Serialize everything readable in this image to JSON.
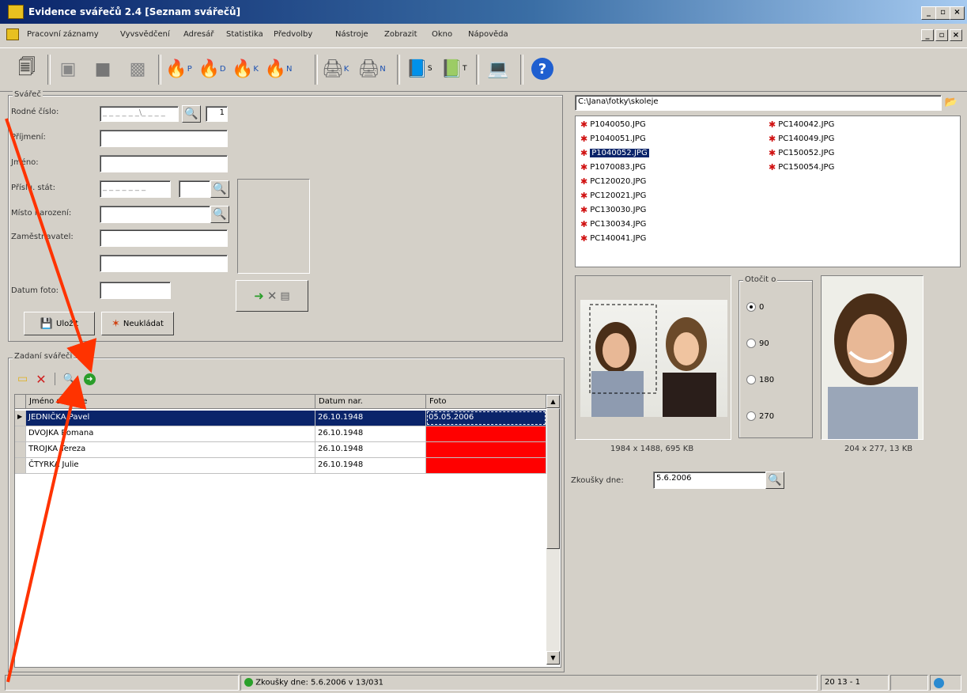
{
  "window": {
    "title": "Evidence svářečů 2.4  [Seznam svářečů]",
    "buttons": [
      "_",
      "▫",
      "×"
    ]
  },
  "menu": {
    "items": [
      "Pracovní záznamy",
      "Vyvsvědčení",
      "Adresář",
      "Statistika",
      "Předvolby",
      "Nástroje",
      "Zobrazit",
      "Okno",
      "Nápověda"
    ]
  },
  "toolbar": {
    "icons": [
      {
        "name": "doc-icon",
        "glyph": "🗐"
      },
      {
        "name": "stamp-icon",
        "glyph": "▣"
      },
      {
        "name": "stop-icon",
        "glyph": "■"
      },
      {
        "name": "tools-icon",
        "glyph": "▩"
      },
      {
        "name": "torch-p-icon",
        "glyph": "🔥",
        "sub": "P"
      },
      {
        "name": "torch-d-icon",
        "glyph": "🔥",
        "sub": "D"
      },
      {
        "name": "torch-zk-icon",
        "glyph": "🔥",
        "sub": "K"
      },
      {
        "name": "torch-en-icon",
        "glyph": "🔥",
        "sub": "N"
      },
      {
        "name": "print-zk-icon",
        "glyph": "🖨",
        "sub": "K"
      },
      {
        "name": "print-en-icon",
        "glyph": "🖨",
        "sub": "N"
      },
      {
        "name": "book-s-icon",
        "glyph": "📘",
        "sub": "S"
      },
      {
        "name": "book-t-icon",
        "glyph": "📗",
        "sub": "T"
      },
      {
        "name": "computer-icon",
        "glyph": "💻"
      },
      {
        "name": "help-icon",
        "glyph": "?"
      }
    ]
  },
  "welder": {
    "group_label": "Svářeč",
    "rodne_cislo_label": "Rodné číslo:",
    "rodne_cislo_value": "_ _ _ _ _ _\\_ _ _ _",
    "rodne_cislo_suffix": "1",
    "prijmeni_label": "Příjmení:",
    "jmeno_label": "Jméno:",
    "prist_label": "Příslu. stát:",
    "prist_value": "_ _ _ _ _ _ _",
    "misto_label": "Místo narození:",
    "zamestnavatel_label": "Zaměstnavatel:",
    "datum_foto_label": "Datum foto:",
    "ulozit": "Uložit",
    "neukladat": "Neukládat"
  },
  "list": {
    "group_label": "Zadaní svářeči",
    "columns": [
      "Jméno svářeče",
      "Datum nar.",
      "Foto"
    ],
    "rows": [
      {
        "name": "JEDNIČKA Pavel",
        "date": "26.10.1948",
        "foto": "05.05.2006",
        "selected": true,
        "red": false
      },
      {
        "name": "DVOJKA Romana",
        "date": "26.10.1948",
        "foto": "",
        "selected": false,
        "red": true
      },
      {
        "name": "TROJKA Tereza",
        "date": "26.10.1948",
        "foto": "",
        "selected": false,
        "red": true
      },
      {
        "name": "ČTYRKA Julie",
        "date": "26.10.1948",
        "foto": "",
        "selected": false,
        "red": true
      }
    ]
  },
  "files": {
    "path": "C:\\Jana\\fotky\\skoleje",
    "col1": [
      "P1040050.JPG",
      "P1040051.JPG",
      "P1040052.JPG",
      "P1070083.JPG",
      "PC120020.JPG",
      "PC120021.JPG",
      "PC130030.JPG",
      "PC130034.JPG",
      "PC140041.JPG"
    ],
    "col2": [
      "PC140042.JPG",
      "PC140049.JPG",
      "PC150052.JPG",
      "PC150054.JPG"
    ],
    "selected": "P1040052.JPG"
  },
  "rotate": {
    "label": "Otočit o",
    "options": [
      "0",
      "90",
      "180",
      "270"
    ],
    "selected": "0"
  },
  "preview": {
    "src_info": "1984 x 1488, 695 KB",
    "dst_info": "204 x 277, 13 KB"
  },
  "zkousky": {
    "label": "Zkoušky dne:",
    "value": "5.6.2006"
  },
  "status": {
    "main": "Zkoušky dne: 5.6.2006 v 13/031",
    "right": "20 13 - 1"
  },
  "colors": {
    "titlebar": "#0a246a",
    "selection": "#0a246a",
    "missing_photo": "#ff0000",
    "annotation_arrow": "#ff3300"
  }
}
